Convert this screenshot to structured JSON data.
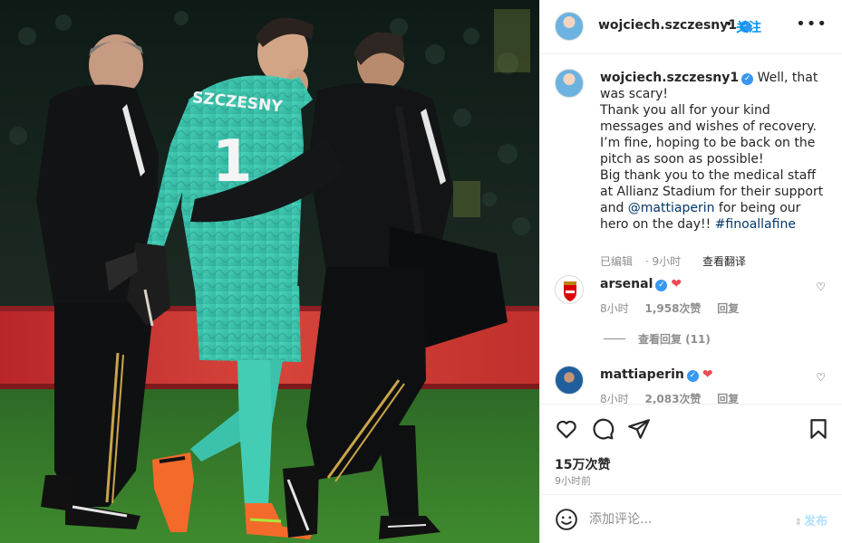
{
  "post": {
    "image_alt": "Goalkeeper in teal kit walking off the pitch with staff",
    "jersey_name": "SZCZESNY",
    "jersey_number": "1"
  },
  "header": {
    "username": "wojciech.szczesny1",
    "verified_mark": "✓",
    "separator": "•",
    "follow_label": "关注",
    "more_label": "•••"
  },
  "caption": {
    "username": "wojciech.szczesny1",
    "text_before_mention": " Well, that was scary!\nThank you all for your kind messages and wishes of recovery. I’m fine, hoping to be back on the pitch as soon as possible!\nBig thank you to the medical staff at Allianz Stadium for their support and ",
    "mention": "@mattiaperin",
    "text_after_mention": " for being our hero on the day!! ",
    "hashtag": "#finoallafine",
    "edited_label": "已编辑",
    "age": "9小时",
    "translate_label": "查看翻译"
  },
  "comments": [
    {
      "username": "arsenal",
      "text": "❤",
      "age": "8小时",
      "likes": "1,958次赞",
      "reply_label": "回复",
      "view_replies": "查看回复 (11)"
    },
    {
      "username": "mattiaperin",
      "text": "❤",
      "age": "8小时",
      "likes": "2,083次赞",
      "reply_label": "回复"
    }
  ],
  "actions": {
    "likes_count": "15万次赞",
    "timestamp": "9小时前"
  },
  "add_comment": {
    "placeholder": "添加评论...",
    "post_label": "发布",
    "post_prefix": "⇕"
  },
  "colors": {
    "link": "#00376b",
    "follow": "#0095f6",
    "verified": "#3897f0",
    "heart": "#ed4956",
    "post_disabled": "#b2dffc",
    "kit_teal": "#3fc7b0"
  }
}
